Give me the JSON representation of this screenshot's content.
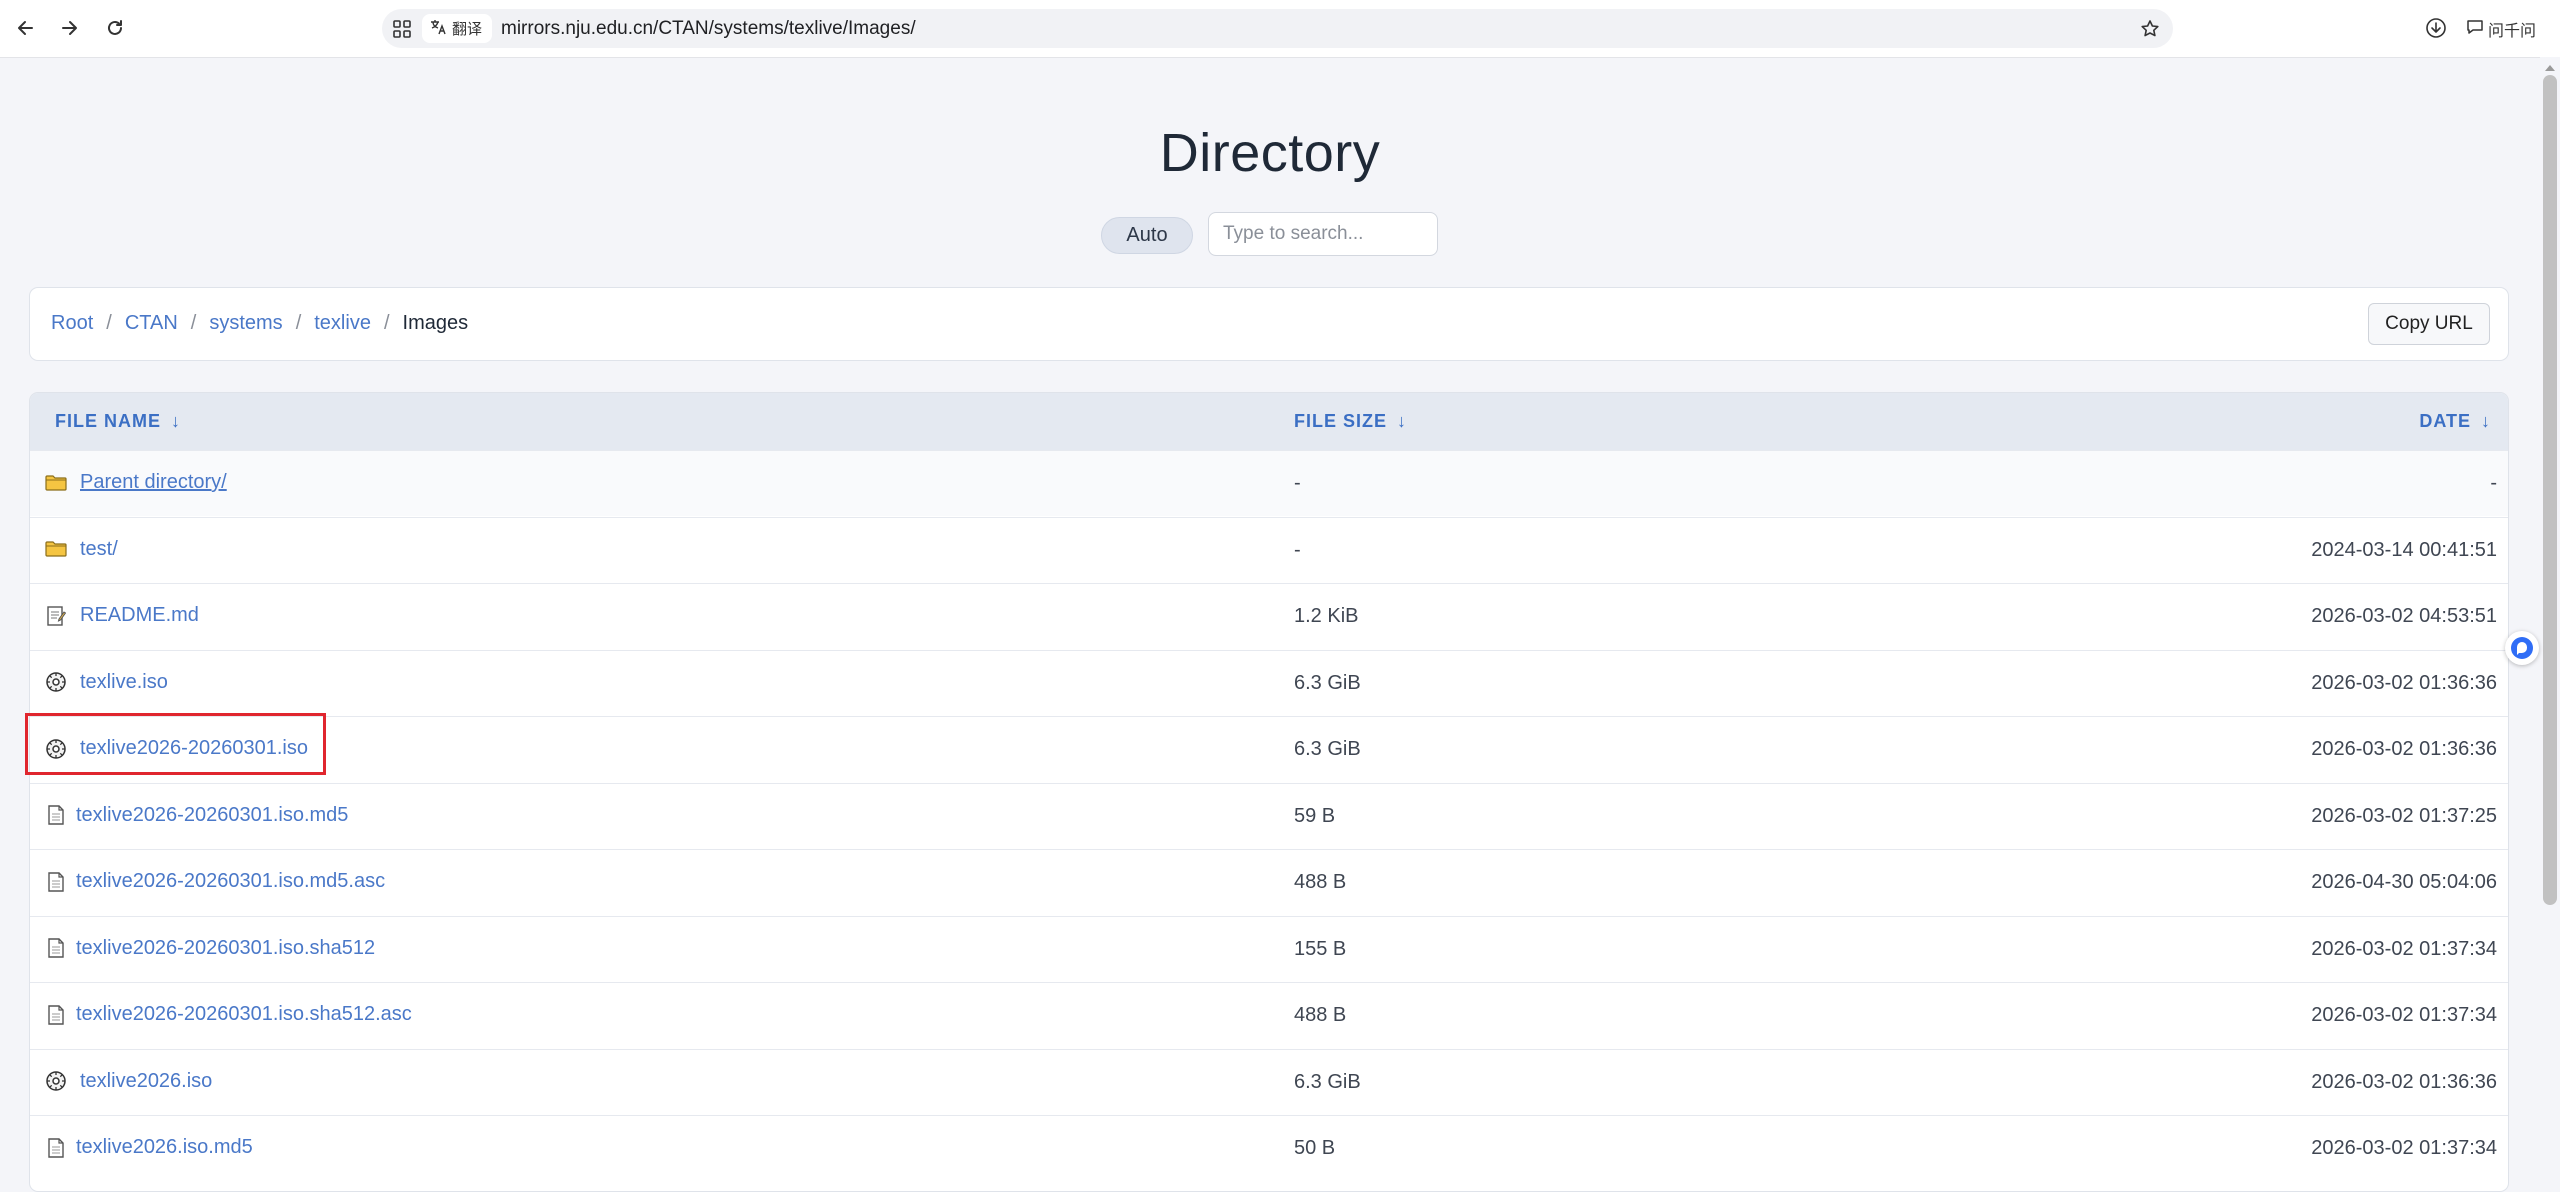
{
  "browser": {
    "url": "mirrors.nju.edu.cn/CTAN/systems/texlive/Images/",
    "translate_label": "翻译",
    "ask_label": "问千问",
    "icons": {
      "back": "back-arrow-icon",
      "forward": "forward-arrow-icon",
      "reload": "reload-icon",
      "apps": "apps-grid-icon",
      "translate": "translate-icon",
      "bookmark": "star-icon",
      "download": "download-icon",
      "ask": "chat-icon"
    }
  },
  "page": {
    "title": "Directory",
    "theme_button": "Auto",
    "search_placeholder": "Type to search..."
  },
  "breadcrumb": {
    "items": [
      "Root",
      "CTAN",
      "systems",
      "texlive"
    ],
    "separator": "/",
    "current": "Images",
    "copy_button": "Copy URL"
  },
  "table": {
    "headers": {
      "name": "FILE NAME",
      "size": "FILE SIZE",
      "date": "DATE",
      "sort_arrow": "↓"
    },
    "rows": [
      {
        "name": "Parent directory/",
        "size": "-",
        "date": "-",
        "type": "folder"
      },
      {
        "name": "test/",
        "size": "-",
        "date": "2024-03-14 00:41:51",
        "type": "folder"
      },
      {
        "name": "README.md",
        "size": "1.2 KiB",
        "date": "2026-03-02 04:53:51",
        "type": "text"
      },
      {
        "name": "texlive.iso",
        "size": "6.3 GiB",
        "date": "2026-03-02 01:36:36",
        "type": "disc"
      },
      {
        "name": "texlive2026-20260301.iso",
        "size": "6.3 GiB",
        "date": "2026-03-02 01:36:36",
        "type": "disc"
      },
      {
        "name": "texlive2026-20260301.iso.md5",
        "size": "59 B",
        "date": "2026-03-02 01:37:25",
        "type": "file"
      },
      {
        "name": "texlive2026-20260301.iso.md5.asc",
        "size": "488 B",
        "date": "2026-04-30 05:04:06",
        "type": "file"
      },
      {
        "name": "texlive2026-20260301.iso.sha512",
        "size": "155 B",
        "date": "2026-03-02 01:37:34",
        "type": "file"
      },
      {
        "name": "texlive2026-20260301.iso.sha512.asc",
        "size": "488 B",
        "date": "2026-03-02 01:37:34",
        "type": "file"
      },
      {
        "name": "texlive2026.iso",
        "size": "6.3 GiB",
        "date": "2026-03-02 01:36:36",
        "type": "disc"
      },
      {
        "name": "texlive2026.iso.md5",
        "size": "50 B",
        "date": "2026-03-02 01:37:34",
        "type": "file"
      }
    ]
  },
  "colors": {
    "link": "#4a78c8",
    "header_bg": "#e4e9f1",
    "highlight": "#e0262e"
  }
}
